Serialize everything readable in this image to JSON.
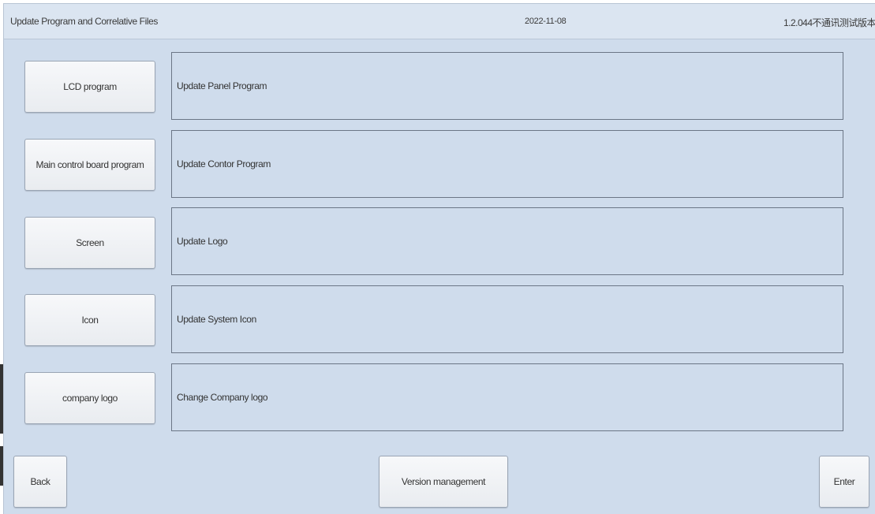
{
  "header": {
    "title": "Update Program and Correlative Files",
    "date": "2022-11-08",
    "version": "1.2.044不通讯测试版本"
  },
  "rows": [
    {
      "button_label": "LCD program",
      "description": "Update Panel Program"
    },
    {
      "button_label": "Main control board program",
      "description": "Update Contor Program"
    },
    {
      "button_label": "Screen",
      "description": "Update Logo"
    },
    {
      "button_label": "Icon",
      "description": "Update System Icon"
    },
    {
      "button_label": "company logo",
      "description": "Change Company logo"
    }
  ],
  "footer": {
    "back_label": "Back",
    "version_management_label": "Version management",
    "enter_label": "Enter"
  }
}
